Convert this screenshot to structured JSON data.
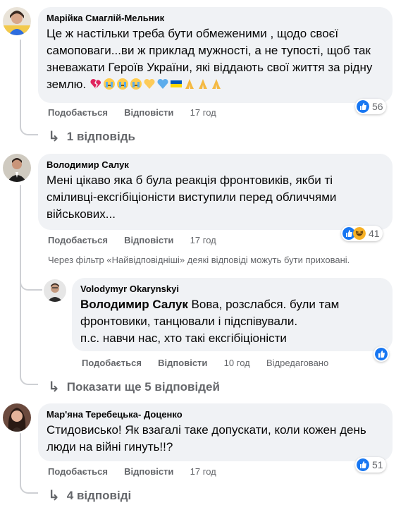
{
  "comments": [
    {
      "author": "Марійка Смаглій-Мельник",
      "text": "Це ж настільки треба бути обмеженими , щодо своєї самоповаги...ви ж приклад мужності, а не тупості, щоб так зневажати Героїв України, які віддають свої життя за рідну землю.",
      "emojis": [
        "broken-heart-emoji",
        "crying-face-emoji",
        "crying-face-emoji",
        "crying-face-emoji",
        "yellow-heart-emoji",
        "blue-heart-emoji",
        "ukraine-flag-emoji",
        "folded-hands-emoji",
        "folded-hands-emoji",
        "folded-hands-emoji"
      ],
      "like": "Подобається",
      "reply": "Відповісти",
      "time": "17 год",
      "reactions": "56",
      "replies": "1 відповідь"
    },
    {
      "author": "Володимир Салук",
      "text": "Мені цікаво яка б була реакція фронтовиків, якби ті сміливці-ексгібіціоністи виступили перед обличчями військових...",
      "like": "Подобається",
      "reply": "Відповісти",
      "time": "17 год",
      "reactions": "41",
      "notice": "Через фільтр «Найвідповідніші» деякі відповіді можуть бути приховані.",
      "nested": {
        "author": "Volodymyr Okarynskyi",
        "mention": "Володимир Салук",
        "text": " Вова, розслабся. були там фронтовики, танцювали і підспівували.",
        "text2": "п.с. навчи нас, хто такі ексгібіціоністи",
        "like": "Подобається",
        "reply": "Відповісти",
        "time": "10 год",
        "edited": "Відредаговано"
      },
      "more": "Показати ще 5 відповідей"
    },
    {
      "author": "Мар'яна Теребецька- Доценко",
      "text": "Стидовисько! Як взагалі таке допускати, коли кожен день люди на війні гинуть!!?",
      "like": "Подобається",
      "reply": "Відповісти",
      "time": "17 год",
      "reactions": "51",
      "replies": "4 відповіді"
    }
  ],
  "colors": {
    "bubble": "#f0f2f5",
    "like_blue": "#1877f2",
    "muted": "#65676b"
  }
}
